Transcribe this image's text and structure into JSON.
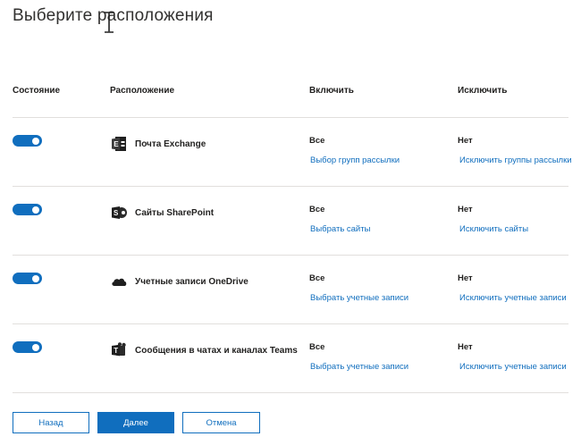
{
  "page": {
    "title": "Выберите расположения"
  },
  "table": {
    "headers": {
      "status": "Состояние",
      "location": "Расположение",
      "include": "Включить",
      "exclude": "Исключить"
    },
    "rows": [
      {
        "enabled": true,
        "icon": "exchange-icon",
        "location": "Почта Exchange",
        "include_value": "Все",
        "include_link": "Выбор групп рассылки",
        "exclude_value": "Нет",
        "exclude_link": "Исключить группы рассылки"
      },
      {
        "enabled": true,
        "icon": "sharepoint-icon",
        "location": "Сайты SharePoint",
        "include_value": "Все",
        "include_link": "Выбрать сайты",
        "exclude_value": "Нет",
        "exclude_link": "Исключить сайты"
      },
      {
        "enabled": true,
        "icon": "onedrive-icon",
        "location": "Учетные записи OneDrive",
        "include_value": "Все",
        "include_link": "Выбрать учетные записи",
        "exclude_value": "Нет",
        "exclude_link": "Исключить учетные записи"
      },
      {
        "enabled": true,
        "icon": "teams-icon",
        "location": "Сообщения в чатах и каналах Teams",
        "include_value": "Все",
        "include_link": "Выбрать учетные записи",
        "exclude_value": "Нет",
        "exclude_link": "Исключить учетные записи"
      }
    ]
  },
  "footer": {
    "back_label": "Назад",
    "next_label": "Далее",
    "cancel_label": "Отмена"
  },
  "colors": {
    "accent": "#106ebe",
    "divider": "#e1dfdd",
    "text": "#201f1e"
  }
}
